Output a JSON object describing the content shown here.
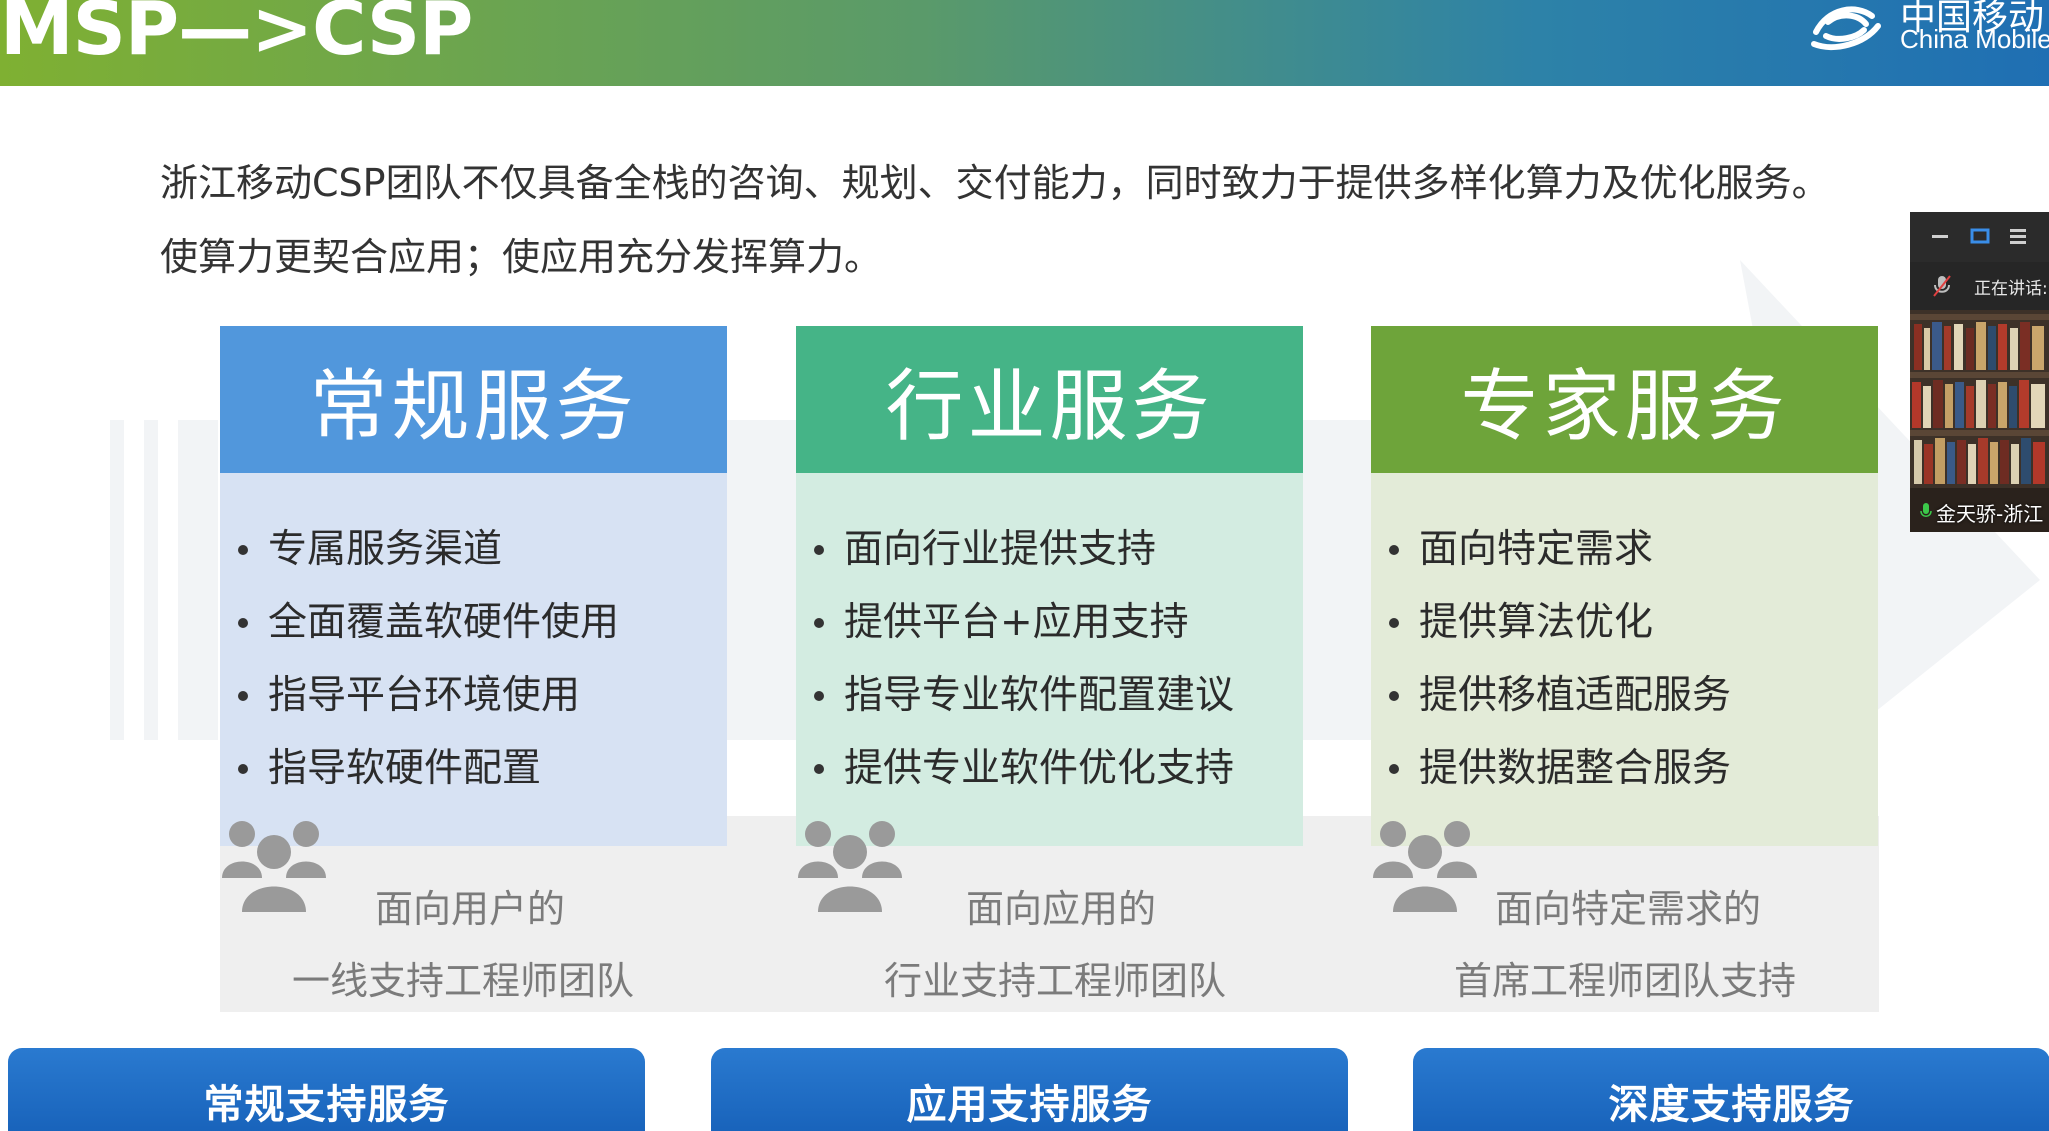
{
  "header": {
    "title": "MSP—>CSP",
    "logo_cn": "中国移动",
    "logo_en": "China Mobile"
  },
  "intro": {
    "line1": "浙江移动CSP团队不仅具备全栈的咨询、规划、交付能力，同时致力于提供多样化算力及优化服务。",
    "line2": "使算力更契合应用；使应用充分发挥算力。"
  },
  "columns": [
    {
      "title": "常规服务",
      "bullets": [
        "专属服务渠道",
        "全面覆盖软硬件使用",
        "指导平台环境使用",
        "指导软硬件配置"
      ],
      "team_line1": "面向用户的",
      "team_line2": "一线支持工程师团队",
      "button": "常规支持服务"
    },
    {
      "title": "行业服务",
      "bullets": [
        "面向行业提供支持",
        "提供平台+应用支持",
        "指导专业软件配置建议",
        "提供专业软件优化支持"
      ],
      "team_line1": "面向应用的",
      "team_line2": "行业支持工程师团队",
      "button": "应用支持服务"
    },
    {
      "title": "专家服务",
      "bullets": [
        "面向特定需求",
        "提供算法优化",
        "提供移植适配服务",
        "提供数据整合服务"
      ],
      "team_line1": "面向特定需求的",
      "team_line2": "首席工程师团队支持",
      "button": "深度支持服务"
    }
  ],
  "video_overlay": {
    "speaking_label": "正在讲话:",
    "participant_name": "金天骄-浙江"
  },
  "colors": {
    "regular": "#5197dc",
    "industry": "#45b487",
    "expert": "#6ea43a",
    "button": "#1f6dc4"
  }
}
